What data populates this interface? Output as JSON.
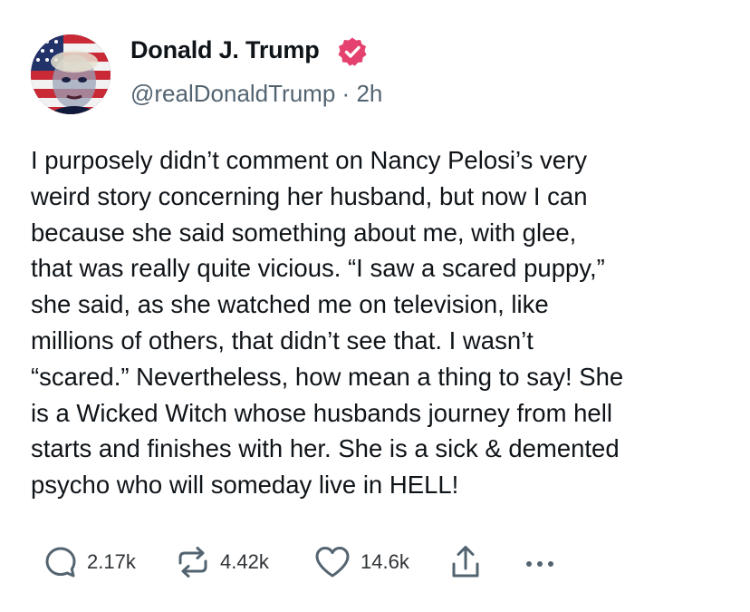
{
  "author": {
    "display_name": "Donald J. Trump",
    "handle": "@realDonaldTrump",
    "separator": "·",
    "time_ago": "2h",
    "verified_color": "#e4416e"
  },
  "post": {
    "lines": [
      "I purposely didn’t comment on Nancy Pelosi’s very",
      "weird story concerning her husband, but now I can",
      "because she said something about me, with glee,",
      "that was really quite vicious. “I saw a scared puppy,”",
      "she said, as she watched me on television, like",
      "millions of others,  that didn’t see that. I wasn’t",
      "“scared.” Nevertheless, how mean a thing to say! She",
      "is a Wicked Witch whose husbands journey from hell",
      "starts and finishes with her. She is a sick & demented",
      "psycho who will someday live in HELL!"
    ]
  },
  "actions": {
    "replies": "2.17k",
    "reposts": "4.42k",
    "likes": "14.6k",
    "reply_icon": "reply-icon",
    "repost_icon": "repost-icon",
    "like_icon": "heart-icon",
    "share_icon": "share-icon",
    "more_icon": "more-icon"
  }
}
